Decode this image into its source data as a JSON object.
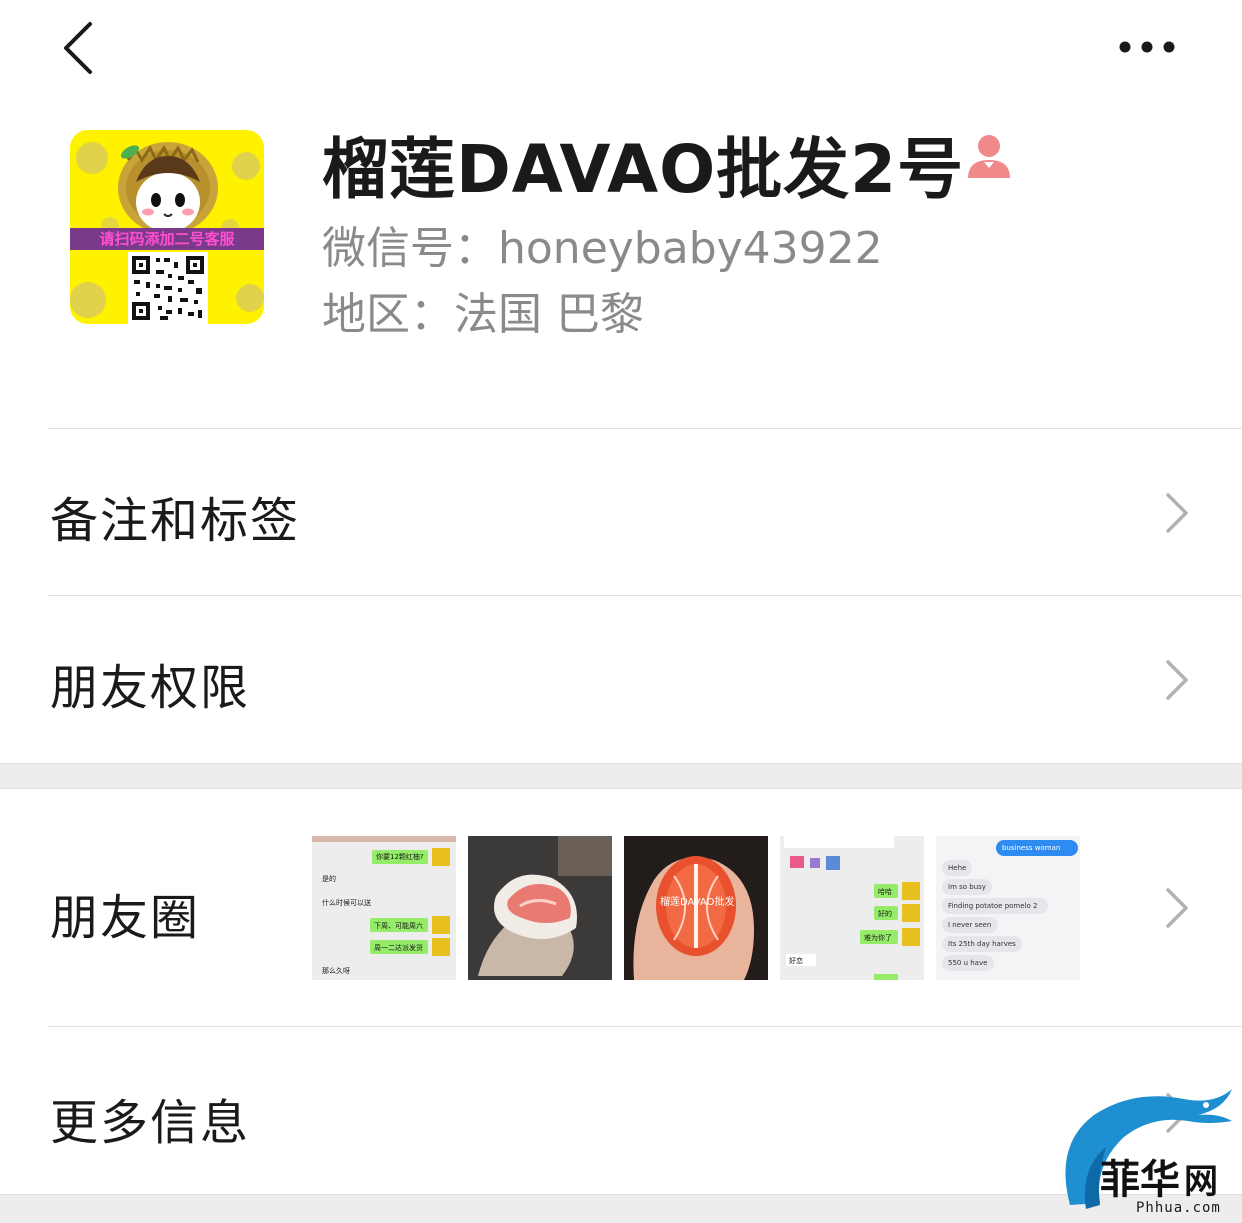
{
  "profile": {
    "name": "榴莲DAVAO批发2号",
    "wechat_id": "微信号：honeybaby43922",
    "region": "地区：法国 巴黎",
    "avatar_banner_text": "请扫码添加二号客服"
  },
  "menu": {
    "remark_tags": "备注和标签",
    "friend_permissions": "朋友权限",
    "moments": "朋友圈",
    "more_info": "更多信息"
  },
  "moments_thumbs": {
    "thumb1": [
      "你要12颗红柚?",
      "是的",
      "什么时候可以送",
      "下周、可能周六",
      "周一二达派发货",
      "那么久呀"
    ],
    "thumb3_label": "榴莲DAVAO批发",
    "thumb4": [
      "哈哈",
      "好的",
      "难为你了",
      "好恋"
    ],
    "thumb5": [
      "business woman",
      "Hehe",
      "Im so busy",
      "Finding potatoe pomelo 2",
      "I never seen",
      "Its 25th day harves",
      "550 u have"
    ]
  },
  "watermark": {
    "brand": "菲华网",
    "site": "Phhua.com"
  },
  "colors": {
    "accent_green": "#95ec69",
    "gender_pink": "#f08a8a",
    "avatar_yellow": "#fff200"
  }
}
